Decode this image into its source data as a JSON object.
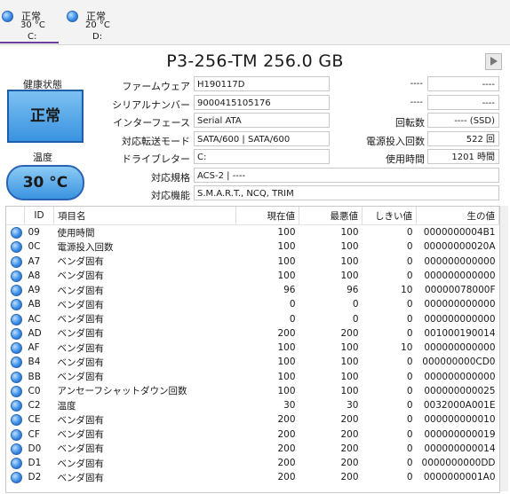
{
  "drives": [
    {
      "status": "正常",
      "temp": "30 °C",
      "letter": "C:",
      "active": true
    },
    {
      "status": "正常",
      "temp": "20 °C",
      "letter": "D:",
      "active": false
    }
  ],
  "model": "P3-256-TM 256.0 GB",
  "health": {
    "label": "健康状態",
    "value": "正常"
  },
  "temperature": {
    "label": "温度",
    "value": "30 °C"
  },
  "fields": {
    "firmware": {
      "label": "ファームウェア",
      "value": "H190117D"
    },
    "serial": {
      "label": "シリアルナンバー",
      "value": "9000415105176"
    },
    "interface": {
      "label": "インターフェース",
      "value": "Serial ATA"
    },
    "transfer": {
      "label": "対応転送モード",
      "value": "SATA/600 | SATA/600"
    },
    "letter": {
      "label": "ドライブレター",
      "value": "C:"
    },
    "standard": {
      "label": "対応規格",
      "value": "ACS-2 | ----"
    },
    "features": {
      "label": "対応機能",
      "value": "S.M.A.R.T., NCQ, TRIM"
    }
  },
  "right_fields": {
    "r1": {
      "label": "----",
      "value": "----"
    },
    "r2": {
      "label": "----",
      "value": "----"
    },
    "rotation": {
      "label": "回転数",
      "value": "---- (SSD)"
    },
    "power_count": {
      "label": "電源投入回数",
      "value": "522 回"
    },
    "hours": {
      "label": "使用時間",
      "value": "1201 時間"
    }
  },
  "table": {
    "headers": {
      "id": "ID",
      "name": "項目名",
      "current": "現在値",
      "worst": "最悪値",
      "threshold": "しきい値",
      "raw": "生の値"
    },
    "rows": [
      {
        "id": "09",
        "name": "使用時間",
        "current": "100",
        "worst": "100",
        "threshold": "0",
        "raw": "0000000004B1"
      },
      {
        "id": "0C",
        "name": "電源投入回数",
        "current": "100",
        "worst": "100",
        "threshold": "0",
        "raw": "00000000020A"
      },
      {
        "id": "A7",
        "name": "ベンダ固有",
        "current": "100",
        "worst": "100",
        "threshold": "0",
        "raw": "000000000000"
      },
      {
        "id": "A8",
        "name": "ベンダ固有",
        "current": "100",
        "worst": "100",
        "threshold": "0",
        "raw": "000000000000"
      },
      {
        "id": "A9",
        "name": "ベンダ固有",
        "current": "96",
        "worst": "96",
        "threshold": "10",
        "raw": "00000078000F"
      },
      {
        "id": "AB",
        "name": "ベンダ固有",
        "current": "0",
        "worst": "0",
        "threshold": "0",
        "raw": "000000000000"
      },
      {
        "id": "AC",
        "name": "ベンダ固有",
        "current": "0",
        "worst": "0",
        "threshold": "0",
        "raw": "000000000000"
      },
      {
        "id": "AD",
        "name": "ベンダ固有",
        "current": "200",
        "worst": "200",
        "threshold": "0",
        "raw": "001000190014"
      },
      {
        "id": "AF",
        "name": "ベンダ固有",
        "current": "100",
        "worst": "100",
        "threshold": "10",
        "raw": "000000000000"
      },
      {
        "id": "B4",
        "name": "ベンダ固有",
        "current": "100",
        "worst": "100",
        "threshold": "0",
        "raw": "000000000CD0"
      },
      {
        "id": "BB",
        "name": "ベンダ固有",
        "current": "100",
        "worst": "100",
        "threshold": "0",
        "raw": "000000000000"
      },
      {
        "id": "C0",
        "name": "アンセーフシャットダウン回数",
        "current": "100",
        "worst": "100",
        "threshold": "0",
        "raw": "000000000025"
      },
      {
        "id": "C2",
        "name": "温度",
        "current": "30",
        "worst": "30",
        "threshold": "0",
        "raw": "0032000A001E"
      },
      {
        "id": "CE",
        "name": "ベンダ固有",
        "current": "200",
        "worst": "200",
        "threshold": "0",
        "raw": "000000000010"
      },
      {
        "id": "CF",
        "name": "ベンダ固有",
        "current": "200",
        "worst": "200",
        "threshold": "0",
        "raw": "000000000019"
      },
      {
        "id": "D0",
        "name": "ベンダ固有",
        "current": "200",
        "worst": "200",
        "threshold": "0",
        "raw": "000000000014"
      },
      {
        "id": "D1",
        "name": "ベンダ固有",
        "current": "200",
        "worst": "200",
        "threshold": "0",
        "raw": "0000000000DD"
      },
      {
        "id": "D2",
        "name": "ベンダ固有",
        "current": "200",
        "worst": "200",
        "threshold": "0",
        "raw": "0000000001A0"
      }
    ]
  }
}
